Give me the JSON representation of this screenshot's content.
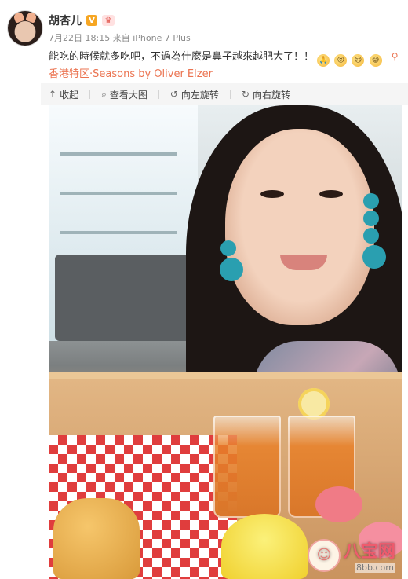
{
  "author": {
    "name": "胡杏儿",
    "verified_badge": "V",
    "member_badge": "♛"
  },
  "meta": {
    "date": "7月22日",
    "time": "18:15",
    "source_prefix": "来自",
    "device": "iPhone 7 Plus"
  },
  "post": {
    "text": "能吃的時候就多吃吧，不過為什麼是鼻子越來越肥大了！！",
    "emojis": [
      "🙏",
      "😝",
      "😢",
      "😂"
    ],
    "location_icon": "map-pin-icon",
    "location": "香港特区·Seasons by Oliver Elzer"
  },
  "toolbar": {
    "collapse": "收起",
    "view_large": "查看大图",
    "rotate_left": "向左旋转",
    "rotate_right": "向右旋转"
  },
  "watermark": {
    "title": "八宝网",
    "url": "8bb.com"
  },
  "colors": {
    "link": "#eb7350",
    "toolbar_bg": "#f5f5f5",
    "verified": "#f6a623"
  }
}
